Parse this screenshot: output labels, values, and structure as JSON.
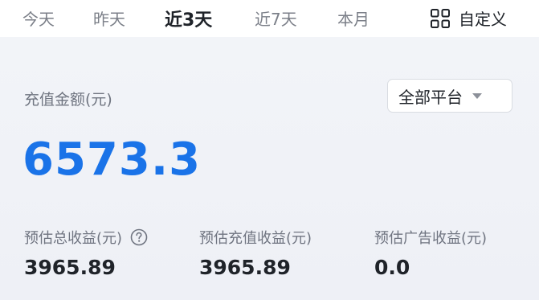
{
  "tabs": [
    {
      "label": "今天",
      "active": false
    },
    {
      "label": "昨天",
      "active": false
    },
    {
      "label": "近3天",
      "active": true
    },
    {
      "label": "近7天",
      "active": false
    },
    {
      "label": "本月",
      "active": false
    }
  ],
  "custom": {
    "icon": "grid-icon",
    "label": "自定义"
  },
  "recharge": {
    "label": "充值金额(元)",
    "amount": "6573.3",
    "platform_select": {
      "value": "全部平台",
      "icon": "caret-down-icon"
    }
  },
  "stats": [
    {
      "label": "预估总收益(元)",
      "value": "3965.89",
      "has_help": true
    },
    {
      "label": "预估充值收益(元)",
      "value": "3965.89",
      "has_help": false
    },
    {
      "label": "预估广告收益(元)",
      "value": "0.0",
      "has_help": false
    }
  ],
  "colors": {
    "accent": "#1a73e8",
    "text_primary": "#1f2329",
    "text_secondary": "#6f7480",
    "background": "#eef0f5"
  }
}
